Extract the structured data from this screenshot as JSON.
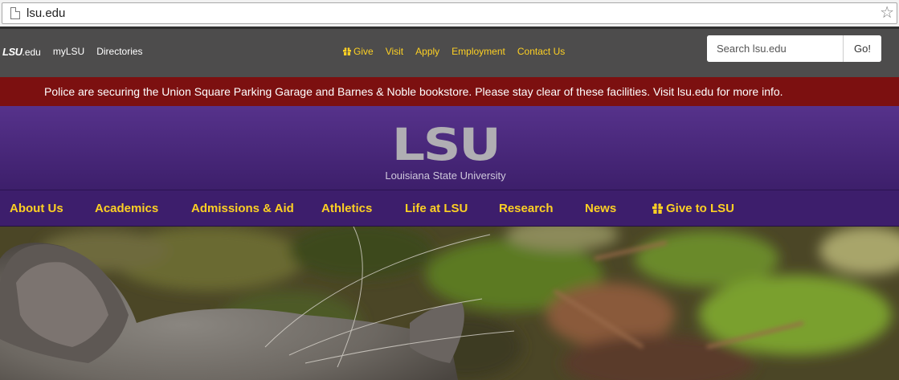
{
  "browser": {
    "url": "lsu.edu"
  },
  "utility": {
    "logo_mark": "LSU",
    "logo_suffix": ".edu",
    "left_links": [
      "myLSU",
      "Directories"
    ],
    "center_links": [
      {
        "label": "Give",
        "icon": "gift-icon"
      },
      {
        "label": "Visit"
      },
      {
        "label": "Apply"
      },
      {
        "label": "Employment"
      },
      {
        "label": "Contact Us"
      }
    ],
    "search": {
      "placeholder": "Search lsu.edu",
      "button": "Go!"
    }
  },
  "alert": {
    "text": "Police are securing the Union Square Parking Garage and Barnes & Noble bookstore. Please stay clear of these facilities. Visit lsu.edu for more info."
  },
  "header": {
    "logo": "LSU",
    "subtitle": "Louisiana State University"
  },
  "nav": {
    "items": [
      {
        "label": "About Us"
      },
      {
        "label": "Academics"
      },
      {
        "label": "Admissions & Aid"
      },
      {
        "label": "Athletics"
      },
      {
        "label": "Life at LSU"
      },
      {
        "label": "Research"
      },
      {
        "label": "News"
      },
      {
        "label": "Give to LSU",
        "icon": "gift-icon"
      }
    ]
  },
  "colors": {
    "purple": "#461d7c",
    "gold": "#fdd023",
    "alert_red": "#7c1010",
    "utility_gray": "#4d4c4c"
  }
}
